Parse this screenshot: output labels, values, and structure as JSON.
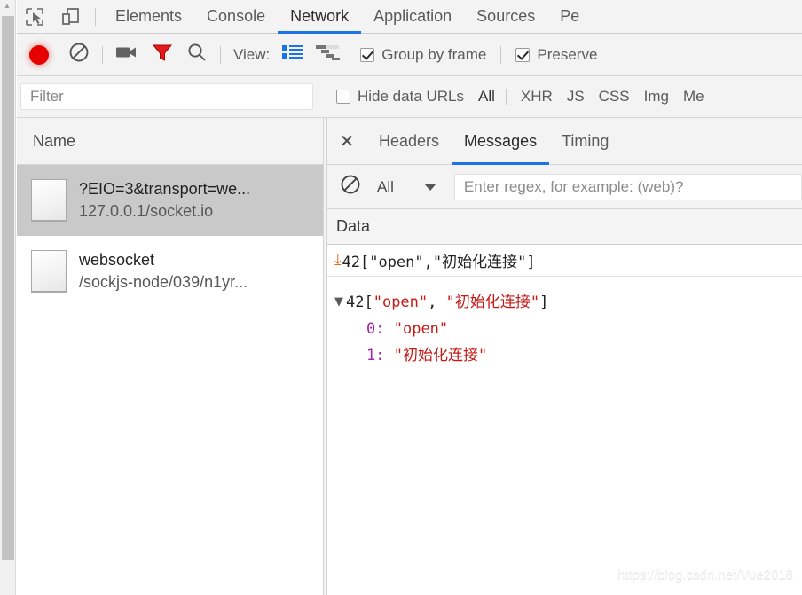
{
  "tabbar": {
    "inspect_icon": "inspect-cursor-icon",
    "device_icon": "device-toolbar-icon",
    "tabs": [
      {
        "label": "Elements",
        "active": false
      },
      {
        "label": "Console",
        "active": false
      },
      {
        "label": "Network",
        "active": true
      },
      {
        "label": "Application",
        "active": false
      },
      {
        "label": "Sources",
        "active": false
      },
      {
        "label": "Pe",
        "active": false
      }
    ]
  },
  "toolbar": {
    "record_icon": "record-button-icon",
    "clear_icon": "clear-icon",
    "camera_icon": "screenshot-camera-icon",
    "filter_icon": "filter-funnel-icon",
    "search_icon": "search-icon",
    "view_label": "View:",
    "list_view_icon": "list-view-icon",
    "waterfall_view_icon": "waterfall-view-icon",
    "group_by_frame": {
      "label": "Group by frame",
      "checked": true
    },
    "preserve_log": {
      "label": "Preserve",
      "checked": true
    }
  },
  "filterbar": {
    "filter_placeholder": "Filter",
    "filter_value": "",
    "hide_data_urls": {
      "label": "Hide data URLs",
      "checked": false
    },
    "types": [
      "All",
      "XHR",
      "JS",
      "CSS",
      "Img",
      "Me"
    ],
    "selected_type": "All"
  },
  "requests": {
    "column_header": "Name",
    "rows": [
      {
        "icon": "document-icon",
        "name": "?EIO=3&transport=we...",
        "domain": "127.0.0.1/socket.io",
        "selected": true
      },
      {
        "icon": "document-icon",
        "name": "websocket",
        "domain": "/sockjs-node/039/n1yr...",
        "selected": false
      }
    ]
  },
  "detail": {
    "close_label": "✕",
    "tabs": [
      {
        "label": "Headers",
        "active": false
      },
      {
        "label": "Messages",
        "active": true
      },
      {
        "label": "Timing",
        "active": false
      }
    ],
    "msgbar": {
      "clear_icon": "clear-icon",
      "type_filter": "All",
      "caret_icon": "chevron-down-icon",
      "regex_placeholder": "Enter regex, for example: (web)?"
    },
    "data_column_header": "Data",
    "messages": [
      {
        "direction_icon": "incoming-arrow-icon",
        "direction_glyph": "⬇",
        "text": "42[\"open\",\"初始化连接\"]"
      }
    ],
    "expanded": {
      "triangle_icon": "triangle-down-icon",
      "triangle_glyph": "▼",
      "summary_prefix": "42[",
      "summary_v0": "\"open\"",
      "summary_comma": ", ",
      "summary_v1": "\"初始化连接\"",
      "summary_suffix": "]",
      "children": [
        {
          "key": "0:",
          "value": "\"open\""
        },
        {
          "key": "1:",
          "value": "\"初始化连接\""
        }
      ]
    }
  },
  "watermark": "https://blog.csdn.net/Vue2018",
  "colors": {
    "accent": "#1a73e8",
    "record_red": "#e60000",
    "filter_red": "#e01b1b",
    "incoming_orange": "#e06c18",
    "string_red": "#c41a16",
    "key_purple": "#aa22aa",
    "selected_row": "#c9c9c9"
  }
}
